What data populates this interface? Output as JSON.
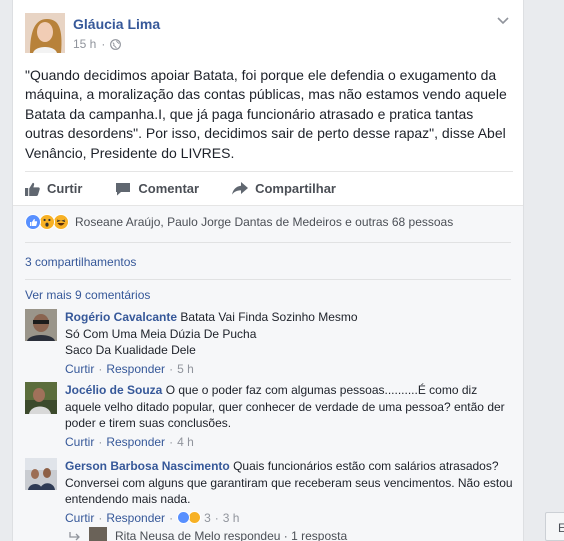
{
  "post": {
    "author": "Gláucia Lima",
    "time": "15 h",
    "text": "\"Quando decidimos apoiar Batata, foi porque ele defendia o exugamento da máquina, a moralização das contas públicas, mas não estamos vendo aquele Batata da campanha.I, que já paga funcionário atrasado e pratica tantas outras desordens\". Por isso, decidimos sair de perto desse rapaz\", disse Abel Venâncio, Presidente do LIVRES."
  },
  "actions": {
    "like": "Curtir",
    "comment": "Comentar",
    "share": "Compartilhar"
  },
  "reactions": {
    "text": "Roseane Araújo, Paulo Jorge Dantas de Medeiros e outras 68 pessoas"
  },
  "shares": "3 compartilhamentos",
  "more_comments": "Ver mais 9 comentários",
  "comments": [
    {
      "name": "Rogério Cavalcante",
      "text_lines": [
        "Batata Vai Finda Sozinho Mesmo",
        "Só Com Uma Meia Dúzia De Pucha",
        "Saco Da Kualidade Dele"
      ],
      "like": "Curtir",
      "reply": "Responder",
      "time": "5 h"
    },
    {
      "name": "Jocélio de Souza",
      "text": "O que o poder faz com algumas pessoas..........É como diz aquele velho ditado popular, quer conhecer de verdade de uma pessoa? então der poder e tirem suas conclusões.",
      "like": "Curtir",
      "reply": "Responder",
      "time": "4 h"
    },
    {
      "name": "Gerson Barbosa Nascimento",
      "text": "Quais funcionários estão com salários atrasados? Conversei com alguns que garantiram que receberam seus vencimentos. Não estou entendendo mais nada.",
      "like": "Curtir",
      "reply": "Responder",
      "reaction_count": "3",
      "time": "3 h"
    }
  ],
  "reply_preview": {
    "text": "Rita Neusa de Melo respondeu · 1 resposta"
  },
  "side_button": "E",
  "colors": {
    "link": "#365899",
    "like_blue": "#5890ff",
    "haha_yellow": "#f7b125"
  }
}
